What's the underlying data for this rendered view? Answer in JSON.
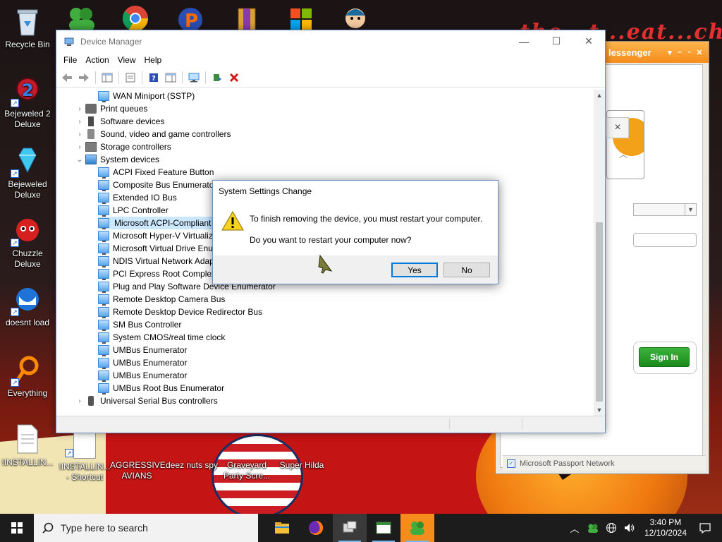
{
  "desktop": {
    "icons_left": [
      {
        "name": "recycle-bin",
        "label": "Recycle Bin",
        "icon": "recycle-bin-icon",
        "shortcut": false
      },
      {
        "name": "bejeweled-2-deluxe",
        "label": "Bejeweled 2 Deluxe",
        "icon": "bejeweled-2-icon",
        "shortcut": true
      },
      {
        "name": "bejeweled-deluxe",
        "label": "Bejeweled Deluxe",
        "icon": "bejeweled-gem-icon",
        "shortcut": true
      },
      {
        "name": "chuzzle-deluxe",
        "label": "Chuzzle Deluxe",
        "icon": "chuzzle-icon",
        "shortcut": true
      },
      {
        "name": "doesnt-load",
        "label": "doesnt load",
        "icon": "thunderbird-icon",
        "shortcut": true
      },
      {
        "name": "everything",
        "label": "Everything",
        "icon": "everything-search-icon",
        "shortcut": true
      },
      {
        "name": "installin-1",
        "label": "!INSTALLIN...",
        "icon": "document-icon",
        "shortcut": false
      }
    ],
    "icons_bottom": [
      {
        "name": "installin-shortcut",
        "label": "!INSTALLIN... - Shortcut"
      },
      {
        "name": "aggressive-avians",
        "label": "AGGRESSIVE AVIANS"
      },
      {
        "name": "deez-nuts-spy",
        "label": "deez nuts spy"
      },
      {
        "name": "graveyard-party",
        "label": "Graveyard Party Scre..."
      },
      {
        "name": "super-hilda",
        "label": "Super Hilda"
      }
    ],
    "wallpaper_text": "...the...t...eat...chit"
  },
  "messenger": {
    "title": "lessenger",
    "signin_label": "Sign In",
    "footer_text": "Microsoft Passport Network",
    "popup_close": "×"
  },
  "device_manager": {
    "title": "Device Manager",
    "menu": [
      "File",
      "Action",
      "View",
      "Help"
    ],
    "tree": [
      {
        "label": "WAN Miniport (SSTP)",
        "level": 2,
        "icon": "monitor",
        "expander": ""
      },
      {
        "label": "Print queues",
        "level": 1,
        "icon": "printer",
        "expander": "›"
      },
      {
        "label": "Software devices",
        "level": 1,
        "icon": "softdev",
        "expander": "›"
      },
      {
        "label": "Sound, video and game controllers",
        "level": 1,
        "icon": "sound",
        "expander": "›"
      },
      {
        "label": "Storage controllers",
        "level": 1,
        "icon": "storage",
        "expander": "›"
      },
      {
        "label": "System devices",
        "level": 1,
        "icon": "sysdev",
        "expander": "⌄"
      },
      {
        "label": "ACPI Fixed Feature Button",
        "level": 2,
        "icon": "monitor",
        "expander": ""
      },
      {
        "label": "Composite Bus Enumerator",
        "level": 2,
        "icon": "monitor",
        "expander": ""
      },
      {
        "label": "Extended IO Bus",
        "level": 2,
        "icon": "monitor",
        "expander": ""
      },
      {
        "label": "LPC Controller",
        "level": 2,
        "icon": "monitor",
        "expander": ""
      },
      {
        "label": "Microsoft ACPI-Compliant System",
        "level": 2,
        "icon": "monitor",
        "expander": "",
        "selected": true
      },
      {
        "label": "Microsoft Hyper-V Virtualization Infrastructure Driver",
        "level": 2,
        "icon": "monitor",
        "expander": ""
      },
      {
        "label": "Microsoft Virtual Drive Enumerator",
        "level": 2,
        "icon": "monitor",
        "expander": ""
      },
      {
        "label": "NDIS Virtual Network Adapter Enumerator",
        "level": 2,
        "icon": "monitor",
        "expander": ""
      },
      {
        "label": "PCI Express Root Complex",
        "level": 2,
        "icon": "monitor",
        "expander": ""
      },
      {
        "label": "Plug and Play Software Device Enumerator",
        "level": 2,
        "icon": "monitor",
        "expander": ""
      },
      {
        "label": "Remote Desktop Camera Bus",
        "level": 2,
        "icon": "monitor",
        "expander": ""
      },
      {
        "label": "Remote Desktop Device Redirector Bus",
        "level": 2,
        "icon": "monitor",
        "expander": ""
      },
      {
        "label": "SM Bus Controller",
        "level": 2,
        "icon": "monitor",
        "expander": ""
      },
      {
        "label": "System CMOS/real time clock",
        "level": 2,
        "icon": "monitor",
        "expander": ""
      },
      {
        "label": "UMBus Enumerator",
        "level": 2,
        "icon": "monitor",
        "expander": ""
      },
      {
        "label": "UMBus Enumerator",
        "level": 2,
        "icon": "monitor",
        "expander": ""
      },
      {
        "label": "UMBus Enumerator",
        "level": 2,
        "icon": "monitor",
        "expander": ""
      },
      {
        "label": "UMBus Root Bus Enumerator",
        "level": 2,
        "icon": "monitor",
        "expander": ""
      },
      {
        "label": "Universal Serial Bus controllers",
        "level": 1,
        "icon": "usb",
        "expander": "›"
      }
    ]
  },
  "dialog": {
    "title": "System Settings Change",
    "message_line1": "To finish removing the device, you must restart your computer.",
    "message_line2": "Do you want to restart your computer now?",
    "yes_label": "Yes",
    "no_label": "No"
  },
  "taskbar": {
    "search_placeholder": "Type here to search",
    "apps": [
      "file-explorer",
      "firefox",
      "device-manager",
      "window-app",
      "msn-messenger"
    ],
    "time": "3:40 PM",
    "date": "12/10/2024"
  },
  "colors": {
    "accent": "#0078d7",
    "selection": "#cce8ff",
    "messenger_orange": "#f58c1c",
    "signin_green": "#1a8a1a",
    "taskbar": "#1c1c1c"
  }
}
